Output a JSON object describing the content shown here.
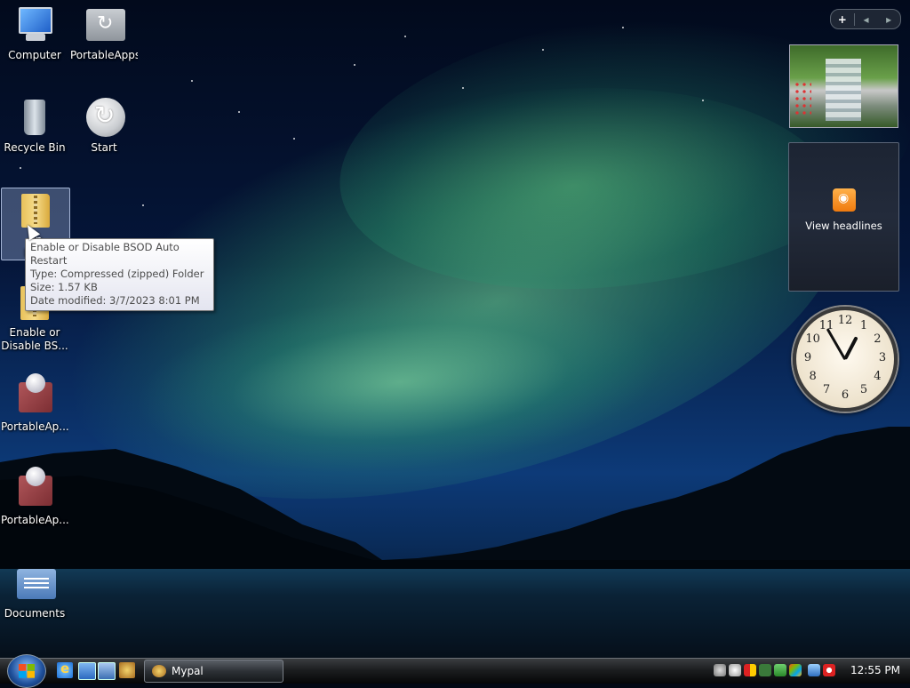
{
  "desktop_icons": [
    {
      "id": "computer",
      "label": "Computer"
    },
    {
      "id": "portableapps-folder",
      "label": "PortableApps"
    },
    {
      "id": "recycle-bin",
      "label": "Recycle Bin"
    },
    {
      "id": "start-shortcut",
      "label": "Start"
    },
    {
      "id": "zip-selected",
      "label": "Enable or Disable BSOD Auto Restart",
      "label_visible_1": "En",
      "label_visible_2": "Disa"
    },
    {
      "id": "zip-2",
      "label_line1": "Enable or",
      "label_line2": "Disable BS..."
    },
    {
      "id": "portableapps-1",
      "label": "PortableAp..."
    },
    {
      "id": "portableapps-2",
      "label": "PortableAp..."
    },
    {
      "id": "documents",
      "label": "Documents"
    }
  ],
  "tooltip": {
    "name": "Enable or Disable BSOD Auto Restart",
    "type": "Type: Compressed (zipped) Folder",
    "size": "Size: 1.57 KB",
    "modified": "Date modified: 3/7/2023 8:01 PM"
  },
  "gadgets": {
    "toolbar": {
      "add": "+",
      "prev": "◂",
      "next": "▸"
    },
    "feed": {
      "label": "View headlines",
      "icon": "rss-icon"
    },
    "clock": {
      "hour": 12,
      "minute": 55,
      "numerals": [
        "12",
        "1",
        "2",
        "3",
        "4",
        "5",
        "6",
        "7",
        "8",
        "9",
        "10",
        "11"
      ]
    }
  },
  "taskbar": {
    "start_icon": "windows-logo-icon",
    "quick_launch": [
      "internet-explorer-icon",
      "show-desktop-icon",
      "switch-windows-icon",
      "mypal-icon"
    ],
    "tasks": [
      {
        "label": "Mypal",
        "icon": "mypal-icon"
      }
    ],
    "tray_icons": [
      "usb-icon",
      "portableapps-tray-icon",
      "security-shield-icon",
      "defender-icon",
      "network-icon",
      "windows-update-icon",
      "display-icon",
      "volume-muted-icon"
    ],
    "time": "12:55 PM"
  },
  "colors": {
    "accent": "#1e4f9a",
    "tooltip_bg": "#ffffff",
    "aurora": "#6fe08c"
  }
}
